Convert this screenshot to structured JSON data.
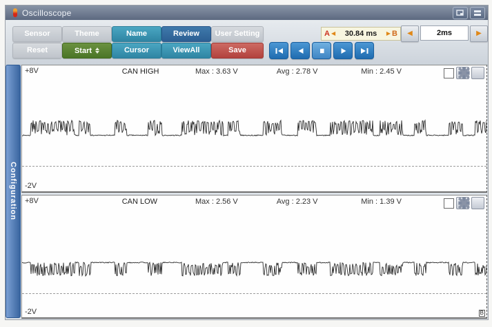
{
  "titlebar": {
    "title": "Oscilloscope"
  },
  "toolbar": {
    "sensor": "Sensor",
    "theme": "Theme",
    "name": "Name",
    "review": "Review",
    "user_setting": "User Setting",
    "reset": "Reset",
    "start": "Start",
    "cursor": "Cursor",
    "viewall": "ViewAll",
    "save": "Save",
    "ab_range": {
      "a": "A",
      "value": "30.84 ms",
      "b": "B"
    },
    "timebase": "2ms"
  },
  "sidebar": {
    "label": "Configuration"
  },
  "corner_label": "B",
  "channels": [
    {
      "top_label": "+8V",
      "bottom_label": "-2V",
      "name": "CAN HIGH",
      "max": "Max : 3.63 V",
      "avg": "Avg : 2.78 V",
      "min": "Min : 2.45 V"
    },
    {
      "top_label": "+8V",
      "bottom_label": "-2V",
      "name": "CAN LOW",
      "max": "Max : 2.56 V",
      "avg": "Avg : 2.23 V",
      "min": "Min : 1.39 V"
    }
  ],
  "chart_data": [
    {
      "type": "line",
      "title": "CAN HIGH",
      "ylabel": "V",
      "ylim": [
        -2,
        8
      ],
      "x_window": "30.84 ms",
      "timebase_per_div": "2ms",
      "max_v": 3.63,
      "avg_v": 2.78,
      "min_v": 2.45,
      "v_top": 8,
      "v_bottom": -2,
      "baseline": 2.45,
      "base_jitter": 0.08,
      "active": 3.48,
      "active_jitter": 0.32,
      "mid": 2.72,
      "mid_jitter": 0.55,
      "seed": 7,
      "bursts": [
        [
          0.019,
          0.114
        ],
        [
          0.123,
          0.148
        ],
        [
          0.2,
          0.225
        ],
        [
          0.271,
          0.301
        ],
        [
          0.344,
          0.433
        ],
        [
          0.444,
          0.47
        ],
        [
          0.519,
          0.559
        ],
        [
          0.593,
          0.633
        ],
        [
          0.664,
          0.756
        ],
        [
          0.77,
          0.819
        ],
        [
          0.844,
          0.87
        ],
        [
          0.919,
          0.948
        ],
        [
          0.975,
          1.0
        ]
      ]
    },
    {
      "type": "line",
      "title": "CAN LOW",
      "ylabel": "V",
      "ylim": [
        -2,
        8
      ],
      "x_window": "30.84 ms",
      "timebase_per_div": "2ms",
      "max_v": 2.56,
      "avg_v": 2.23,
      "min_v": 1.39,
      "v_top": 8,
      "v_bottom": -2,
      "baseline": 2.5,
      "base_jitter": 0.08,
      "active": 1.55,
      "active_jitter": 0.3,
      "mid": 2.28,
      "mid_jitter": 0.48,
      "seed": 13,
      "bursts": [
        [
          0.019,
          0.114
        ],
        [
          0.123,
          0.148
        ],
        [
          0.2,
          0.225
        ],
        [
          0.271,
          0.301
        ],
        [
          0.344,
          0.433
        ],
        [
          0.444,
          0.47
        ],
        [
          0.519,
          0.559
        ],
        [
          0.593,
          0.633
        ],
        [
          0.664,
          0.756
        ],
        [
          0.77,
          0.819
        ],
        [
          0.844,
          0.87
        ],
        [
          0.919,
          0.948
        ],
        [
          0.975,
          1.0
        ]
      ]
    }
  ]
}
